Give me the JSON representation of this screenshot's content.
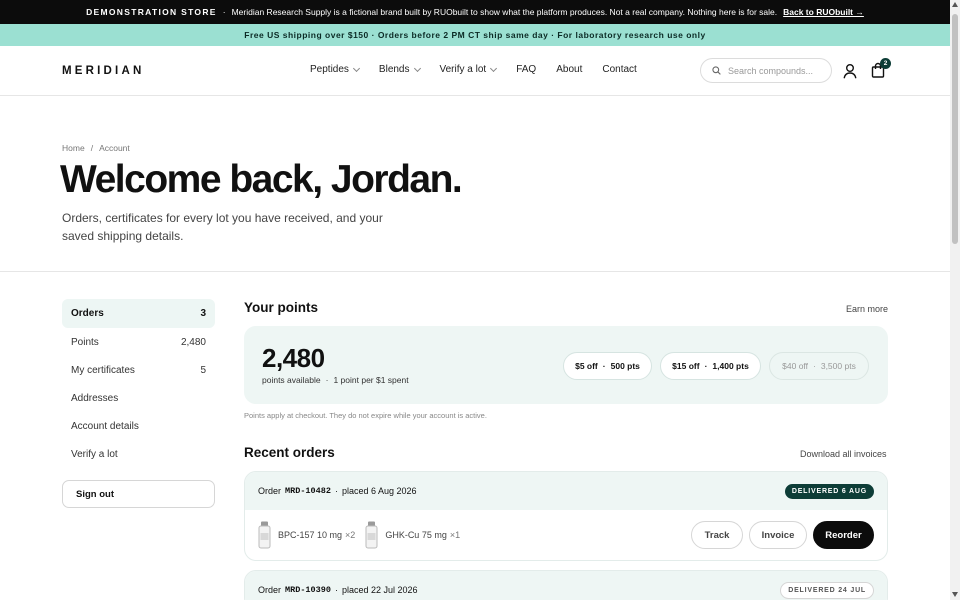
{
  "demo_bar": {
    "brand": "DEMONSTRATION STORE",
    "sep": "·",
    "message": "Meridian Research Supply is a fictional brand built by RUObuilt to show what the platform produces. Not a real company. Nothing here is for sale.",
    "link": "Back to RUObuilt →"
  },
  "ship_bar": {
    "text": "Free US shipping over $150 · Orders before 2 PM CT ship same day · For laboratory research use only"
  },
  "header": {
    "logo": "MERIDIAN",
    "menu": [
      {
        "label": "Peptides",
        "dropdown": true
      },
      {
        "label": "Blends",
        "dropdown": true
      },
      {
        "label": "Verify a lot",
        "dropdown": true
      },
      {
        "label": "FAQ",
        "dropdown": false
      },
      {
        "label": "About",
        "dropdown": false
      },
      {
        "label": "Contact",
        "dropdown": false
      }
    ],
    "search_placeholder": "Search compounds...",
    "cart_count": "2"
  },
  "hero": {
    "breadcrumb": [
      "Home",
      "/",
      "Account"
    ],
    "title": "Welcome back, Jordan.",
    "subtitle": "Orders, certificates for every lot you have received, and your saved shipping details."
  },
  "sidebar": {
    "items": [
      {
        "label": "Orders",
        "count": "3",
        "active": true
      },
      {
        "label": "Points",
        "count": "2,480",
        "active": false
      },
      {
        "label": "My certificates",
        "count": "5",
        "active": false
      },
      {
        "label": "Addresses",
        "count": "",
        "active": false
      },
      {
        "label": "Account details",
        "count": "",
        "active": false
      },
      {
        "label": "Verify a lot",
        "count": "",
        "active": false
      }
    ],
    "signout": "Sign out"
  },
  "points": {
    "title": "Your points",
    "earn_link": "Earn more",
    "balance": "2,480",
    "caption": "points available",
    "sep": "·",
    "rate": "1 point per $1 spent",
    "rewards": [
      {
        "discount": "$5 off",
        "sep": "·",
        "cost": "500 pts",
        "available": true
      },
      {
        "discount": "$15 off",
        "sep": "·",
        "cost": "1,400 pts",
        "available": true
      },
      {
        "discount": "$40 off",
        "sep": "·",
        "cost": "3,500 pts",
        "available": false
      }
    ],
    "note": "Points apply at checkout. They do not expire while your account is active."
  },
  "orders": {
    "title": "Recent orders",
    "download_link": "Download all invoices",
    "list": [
      {
        "prefix": "Order",
        "number": "MRD-10482",
        "sep": "·",
        "placed": "placed 6 Aug 2026",
        "status": "DELIVERED 6 AUG",
        "items": [
          {
            "name": "BPC-157 10 mg",
            "qty": "×2"
          },
          {
            "name": "GHK-Cu 75 mg",
            "qty": "×1"
          }
        ],
        "actions": [
          "Track",
          "Invoice",
          "Reorder"
        ]
      },
      {
        "prefix": "Order",
        "number": "MRD-10390",
        "sep": "·",
        "placed": "placed 22 Jul 2026",
        "status": "DELIVERED 24 JUL"
      }
    ]
  },
  "colors": {
    "accent_dark": "#0d3d37",
    "mint": "#9be0d2",
    "card_bg": "#eef6f4"
  }
}
